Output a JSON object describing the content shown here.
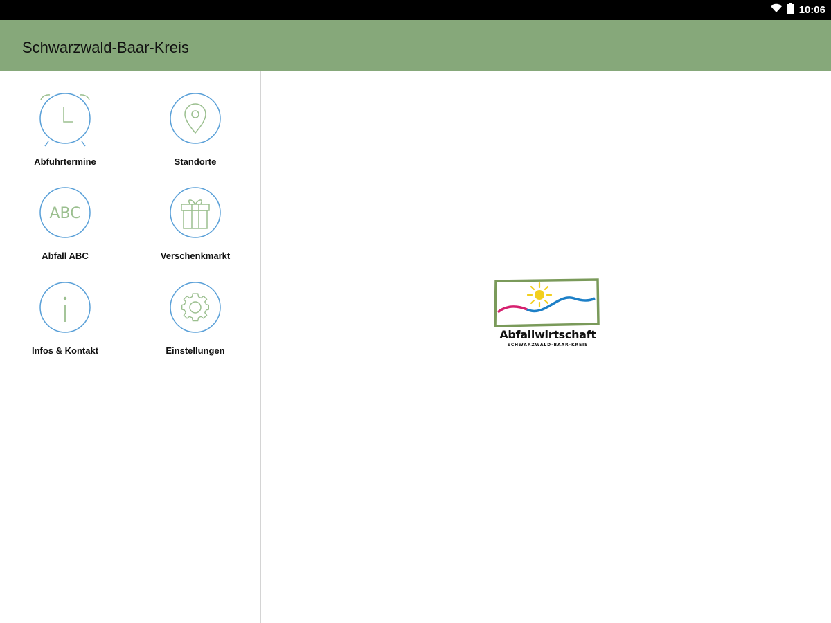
{
  "status_bar": {
    "time": "10:06",
    "icons": [
      "wifi-icon",
      "battery-icon"
    ]
  },
  "app_bar": {
    "title": "Schwarzwald-Baar-Kreis",
    "color": "#86a87a"
  },
  "menu": {
    "items": [
      {
        "label": "Abfuhrtermine",
        "icon": "alarm-clock-icon"
      },
      {
        "label": "Standorte",
        "icon": "location-pin-icon"
      },
      {
        "label": "Abfall ABC",
        "icon": "abc-icon",
        "icon_text": "ABC"
      },
      {
        "label": "Verschenkmarkt",
        "icon": "gift-icon"
      },
      {
        "label": "Infos & Kontakt",
        "icon": "info-icon"
      },
      {
        "label": "Einstellungen",
        "icon": "gear-icon"
      }
    ]
  },
  "logo": {
    "title": "Abfallwirtschaft",
    "subtitle": "SCHWARZWALD-BAAR-KREIS",
    "icon": "sun-wave-logo"
  },
  "colors": {
    "icon_ring": "#5aa0d8",
    "icon_glyph": "#9bbf8f",
    "logo_frame": "#7a9a5a",
    "logo_sun": "#f2cf1f",
    "logo_pink": "#d6206f",
    "logo_blue": "#1c7fc7"
  }
}
